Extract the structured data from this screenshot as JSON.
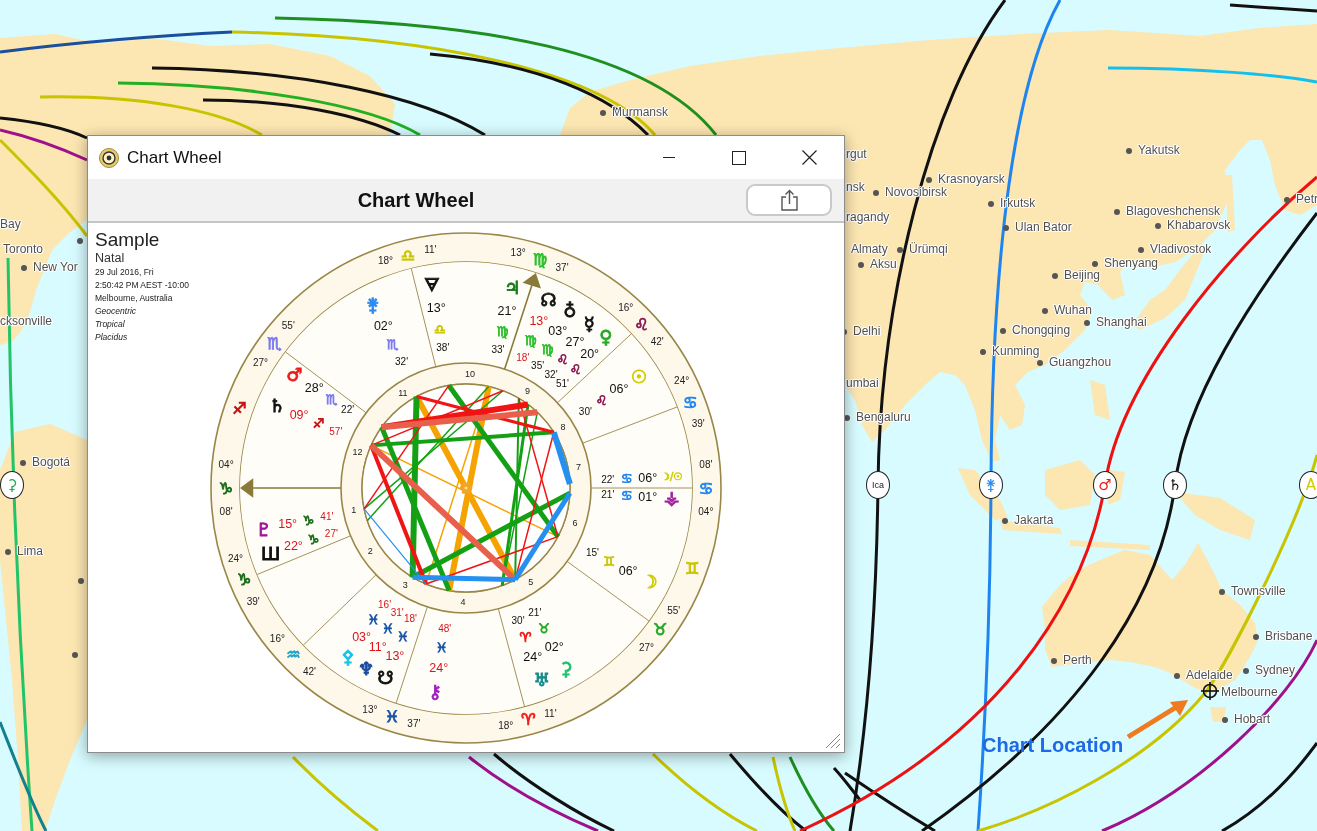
{
  "map": {
    "cities": [
      "Murmansk",
      "Bay",
      "Toronto",
      "New Yor",
      "cksonville",
      "Bogotá",
      "Lima",
      "rgut",
      "nsk",
      "Novosibirsk",
      "Krasnoyarsk",
      "Irkutsk",
      "Ulan Bator",
      "ragandy",
      "Almaty",
      "Ürümqi",
      "Aksu",
      "Yakutsk",
      "Blagoveshchensk",
      "Khabarovsk",
      "Vladivostok",
      "Shenyang",
      "Beijing",
      "Petr",
      "Delhi",
      "Chongqing",
      "Wuhan",
      "Shanghai",
      "Kunming",
      "Guangzhou",
      "umbai",
      "Bengaluru",
      "Jakarta",
      "Townsville",
      "Brisbane",
      "Perth",
      "Adelaide",
      "Sydney",
      "Melbourne",
      "Hobart"
    ],
    "line_markers": [
      {
        "label": "⚳",
        "kind": "glyph",
        "color": "#1fae5a"
      },
      {
        "label": "Ica",
        "kind": "text",
        "color": "#222222"
      },
      {
        "label": "⚵",
        "kind": "glyph",
        "color": "#2b8cf2"
      },
      {
        "label": "♂",
        "kind": "glyph",
        "color": "#ee1c1c"
      },
      {
        "label": "♄",
        "kind": "glyph",
        "color": "#111111"
      },
      {
        "label": "A",
        "kind": "glyph",
        "color": "#cfcc00"
      }
    ],
    "location_label": "Chart Location"
  },
  "window": {
    "title": "Chart Wheel",
    "header": "Chart Wheel"
  },
  "chart_info": {
    "name": "Sample",
    "chart_type": "Natal",
    "details": [
      {
        "text": "29 Jul 2016, Fri",
        "italic": false
      },
      {
        "text": "2:50:42 PM AEST -10:00",
        "italic": false
      },
      {
        "text": "Melbourne, Australia",
        "italic": false
      },
      {
        "text": "Geocentric",
        "italic": true
      },
      {
        "text": "Tropical",
        "italic": true
      },
      {
        "text": "Placidus",
        "italic": true
      }
    ]
  },
  "wheel": {
    "cusps": [
      {
        "degree": "18°",
        "sign": "♎",
        "color": "#c9c600",
        "minutes": "11'"
      },
      {
        "degree": "13°",
        "sign": "♍",
        "color": "#2cbf2c",
        "minutes": "37'"
      },
      {
        "degree": "27°",
        "sign": "♏",
        "color": "#7b7bef",
        "minutes": "55'"
      },
      {
        "degree": "16°",
        "sign": "♌",
        "color": "#8e1f55",
        "minutes": "42'"
      },
      {
        "degree": "24°",
        "sign": "♋",
        "color": "#2187f0",
        "minutes": "39'"
      },
      {
        "degree": "04°",
        "sign": "♑",
        "color": "#1b6e1b",
        "minutes": "08'"
      },
      {
        "degree": "04°",
        "sign": "♋",
        "color": "#2187f0",
        "minutes": "08'"
      },
      {
        "degree": "24°",
        "sign": "♑",
        "color": "#1b6e1b",
        "minutes": "39'"
      },
      {
        "degree": "16°",
        "sign": "♒",
        "color": "#1ea5c8",
        "minutes": "42'"
      },
      {
        "degree": "27°",
        "sign": "♉",
        "color": "#27a827",
        "minutes": "55'"
      },
      {
        "degree": "13°",
        "sign": "♓",
        "color": "#1a55a8",
        "minutes": "37'"
      },
      {
        "degree": "18°",
        "sign": "♈",
        "color": "#ee1c1c",
        "minutes": "11'"
      }
    ],
    "band_signs": [
      {
        "sign": "♐",
        "color": "#c81414"
      },
      {
        "sign": "♊",
        "color": "#c9c600"
      }
    ],
    "house_numbers": [
      "1",
      "2",
      "3",
      "4",
      "5",
      "6",
      "7",
      "8",
      "9",
      "10",
      "11",
      "12"
    ],
    "planets": [
      {
        "glyph": "♄",
        "kind": "glyph",
        "color": "#111111",
        "degree": "09°",
        "sign": {
          "glyph": "♐",
          "color": "#c81414"
        },
        "minutes": "57'",
        "retrograde": true
      },
      {
        "glyph": "♂",
        "kind": "glyph",
        "color": "#ee1c1c",
        "degree": "28°",
        "sign": {
          "glyph": "♏",
          "color": "#7b7bef"
        },
        "minutes": "22'",
        "retrograde": false
      },
      {
        "glyph": "⚵",
        "kind": "glyph",
        "color": "#2b8cf2",
        "degree": "02°",
        "sign": {
          "glyph": "♏",
          "color": "#7b7bef"
        },
        "minutes": "32'",
        "retrograde": false
      },
      {
        "glyph": "🜃",
        "kind": "glyph",
        "color": "#111111",
        "degree": "13°",
        "sign": {
          "glyph": "♎",
          "color": "#c9c600"
        },
        "minutes": "38'",
        "retrograde": false
      },
      {
        "glyph": "♃",
        "kind": "glyph",
        "color": "#1a7a1a",
        "degree": "21°",
        "sign": {
          "glyph": "♍",
          "color": "#2cbf2c"
        },
        "minutes": "33'",
        "retrograde": false
      },
      {
        "glyph": "☊",
        "kind": "glyph",
        "color": "#111111",
        "degree": "13°",
        "sign": {
          "glyph": "♍",
          "color": "#2cbf2c"
        },
        "minutes": "18'",
        "retrograde": true
      },
      {
        "glyph": "♁",
        "kind": "glyph",
        "color": "#111111",
        "degree": "03°",
        "sign": {
          "glyph": "♍",
          "color": "#2cbf2c"
        },
        "minutes": "35'",
        "retrograde": false
      },
      {
        "glyph": "☿",
        "kind": "glyph",
        "color": "#111111",
        "degree": "27°",
        "sign": {
          "glyph": "♌",
          "color": "#8e1f55"
        },
        "minutes": "32'",
        "retrograde": false
      },
      {
        "glyph": "♀",
        "kind": "glyph",
        "color": "#27a827",
        "degree": "20°",
        "sign": {
          "glyph": "♌",
          "color": "#8e1f55"
        },
        "minutes": "51'",
        "retrograde": false
      },
      {
        "glyph": "☉",
        "kind": "glyph",
        "color": "#cfcc00",
        "degree": "06°",
        "sign": {
          "glyph": "♌",
          "color": "#8e1f55"
        },
        "minutes": "30'",
        "retrograde": false
      },
      {
        "glyph": "☽/☉",
        "kind": "compound",
        "color": "#cfcc00",
        "degree": "06°",
        "sign": {
          "glyph": "♋",
          "color": "#2187f0"
        },
        "minutes": "22'",
        "retrograde": false
      },
      {
        "glyph": "⚶",
        "kind": "glyph",
        "color": "#a2209e",
        "degree": "01°",
        "sign": {
          "glyph": "♋",
          "color": "#2187f0"
        },
        "minutes": "21'",
        "retrograde": false
      },
      {
        "glyph": "♇",
        "kind": "glyph",
        "color": "#a2109c",
        "degree": "15°",
        "sign": {
          "glyph": "♑",
          "color": "#1b6e1b"
        },
        "minutes": "41'",
        "retrograde": true
      },
      {
        "glyph": "Ш",
        "kind": "glyph",
        "color": "#111111",
        "degree": "22°",
        "sign": {
          "glyph": "♑",
          "color": "#1b6e1b"
        },
        "minutes": "27'",
        "retrograde": true
      },
      {
        "glyph": "☽",
        "kind": "glyph",
        "color": "#cfcc00",
        "degree": "06°",
        "sign": {
          "glyph": "♊",
          "color": "#c9c600"
        },
        "minutes": "15'",
        "retrograde": false
      },
      {
        "glyph": "⚴",
        "kind": "glyph",
        "color": "#15c3e8",
        "degree": "03°",
        "sign": {
          "glyph": "♓",
          "color": "#1a55a8"
        },
        "minutes": "16'",
        "retrograde": true
      },
      {
        "glyph": "♆",
        "kind": "glyph",
        "color": "#1a4aa0",
        "degree": "11°",
        "sign": {
          "glyph": "♓",
          "color": "#1a55a8"
        },
        "minutes": "31'",
        "retrograde": true
      },
      {
        "glyph": "☋",
        "kind": "glyph",
        "color": "#111111",
        "degree": "13°",
        "sign": {
          "glyph": "♓",
          "color": "#1a55a8"
        },
        "minutes": "18'",
        "retrograde": true
      },
      {
        "glyph": "⚷",
        "kind": "glyph",
        "color": "#a020c0",
        "degree": "24°",
        "sign": {
          "glyph": "♓",
          "color": "#1a55a8"
        },
        "minutes": "48'",
        "retrograde": true
      },
      {
        "glyph": "♅",
        "kind": "glyph",
        "color": "#158a8a",
        "degree": "24°",
        "sign": {
          "glyph": "♈",
          "color": "#ee1c1c"
        },
        "minutes": "30'",
        "retrograde": false
      },
      {
        "glyph": "⚳",
        "kind": "glyph",
        "color": "#1fc070",
        "degree": "02°",
        "sign": {
          "glyph": "♉",
          "color": "#27a827"
        },
        "minutes": "21'",
        "retrograde": false
      }
    ]
  }
}
